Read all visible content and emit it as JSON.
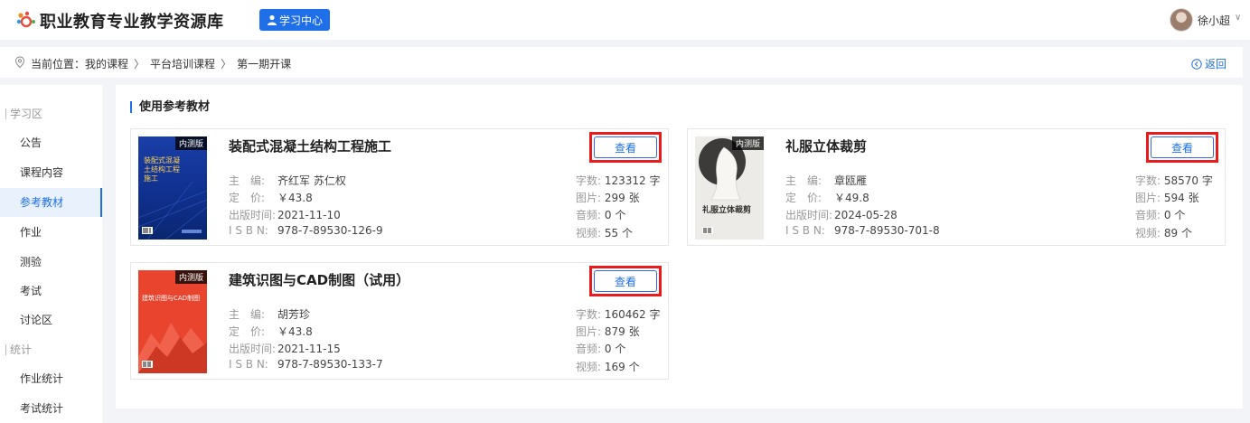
{
  "header": {
    "site_title": "职业教育专业教学资源库",
    "study_center": "学习中心",
    "username": "徐小超"
  },
  "breadcrumb": {
    "prefix": "当前位置：",
    "items": [
      "我的课程",
      "平台培训课程",
      "第一期开课"
    ],
    "separator": "〉",
    "back": "返回"
  },
  "sidebar": {
    "groups": [
      {
        "label": "学习区",
        "items": [
          "公告",
          "课程内容",
          "参考教材",
          "作业",
          "测验",
          "考试",
          "讨论区"
        ]
      },
      {
        "label": "统计",
        "items": [
          "作业统计",
          "考试统计"
        ]
      }
    ],
    "active": "参考教材"
  },
  "main": {
    "section_title": "使用参考教材",
    "labels": {
      "editor": "主　编:",
      "price": "定　价:",
      "pubdate": "出版时间:",
      "isbn": "I S B N:",
      "words": "字数:",
      "images": "图片:",
      "audio": "音频:",
      "video": "视频:"
    },
    "view_label": "查看",
    "books": [
      {
        "title": "装配式混凝土结构工程施工",
        "tag": "内测版",
        "cover_text": "装配式混凝土结构工程施工",
        "editor": "齐红军 苏仁权",
        "price": "￥43.8",
        "pubdate": "2021-11-10",
        "isbn": "978-7-89530-126-9",
        "words": "123312 字",
        "images": "299 张",
        "audio": "0 个",
        "video": "55 个"
      },
      {
        "title": "礼服立体裁剪",
        "tag": "内测版",
        "cover_text": "礼服立体裁剪",
        "editor": "章瓯雁",
        "price": "￥49.8",
        "pubdate": "2024-05-28",
        "isbn": "978-7-89530-701-8",
        "words": "58570 字",
        "images": "594 张",
        "audio": "0 个",
        "video": "89 个"
      },
      {
        "title": "建筑识图与CAD制图（试用）",
        "tag": "内测版",
        "cover_text": "建筑识图与CAD制图",
        "editor": "胡芳珍",
        "price": "￥43.8",
        "pubdate": "2021-11-15",
        "isbn": "978-7-89530-133-7",
        "words": "160462 字",
        "images": "879 张",
        "audio": "0 个",
        "video": "169 个"
      }
    ]
  },
  "colors": {
    "accent": "#1e6fe8",
    "highlight_box": "#e81c1c",
    "page_bg": "#f2f4f8"
  }
}
